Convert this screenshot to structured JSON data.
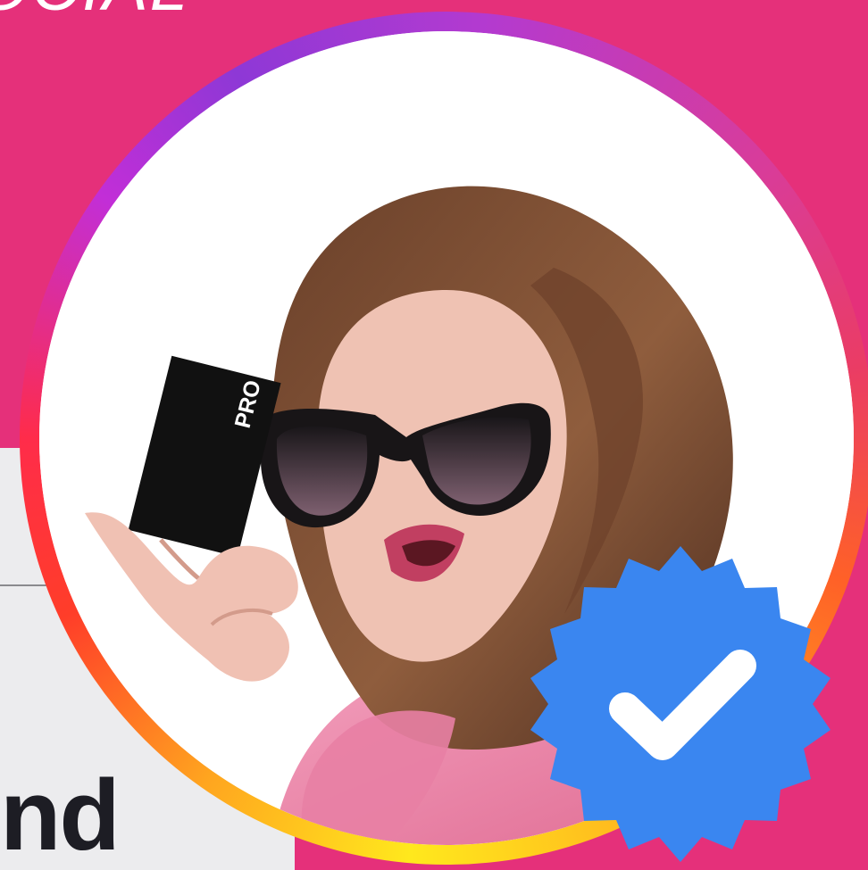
{
  "branding": {
    "top_fragment": "OCIAL",
    "bottom_fragment": "nd"
  },
  "avatar": {
    "card_text": "PRO",
    "badge_icon": "verified-check-icon",
    "colors": {
      "background": "#e5307a",
      "badge": "#3a86f0",
      "ring_start": "#8e38d6",
      "ring_end": "#ffe81d"
    }
  }
}
